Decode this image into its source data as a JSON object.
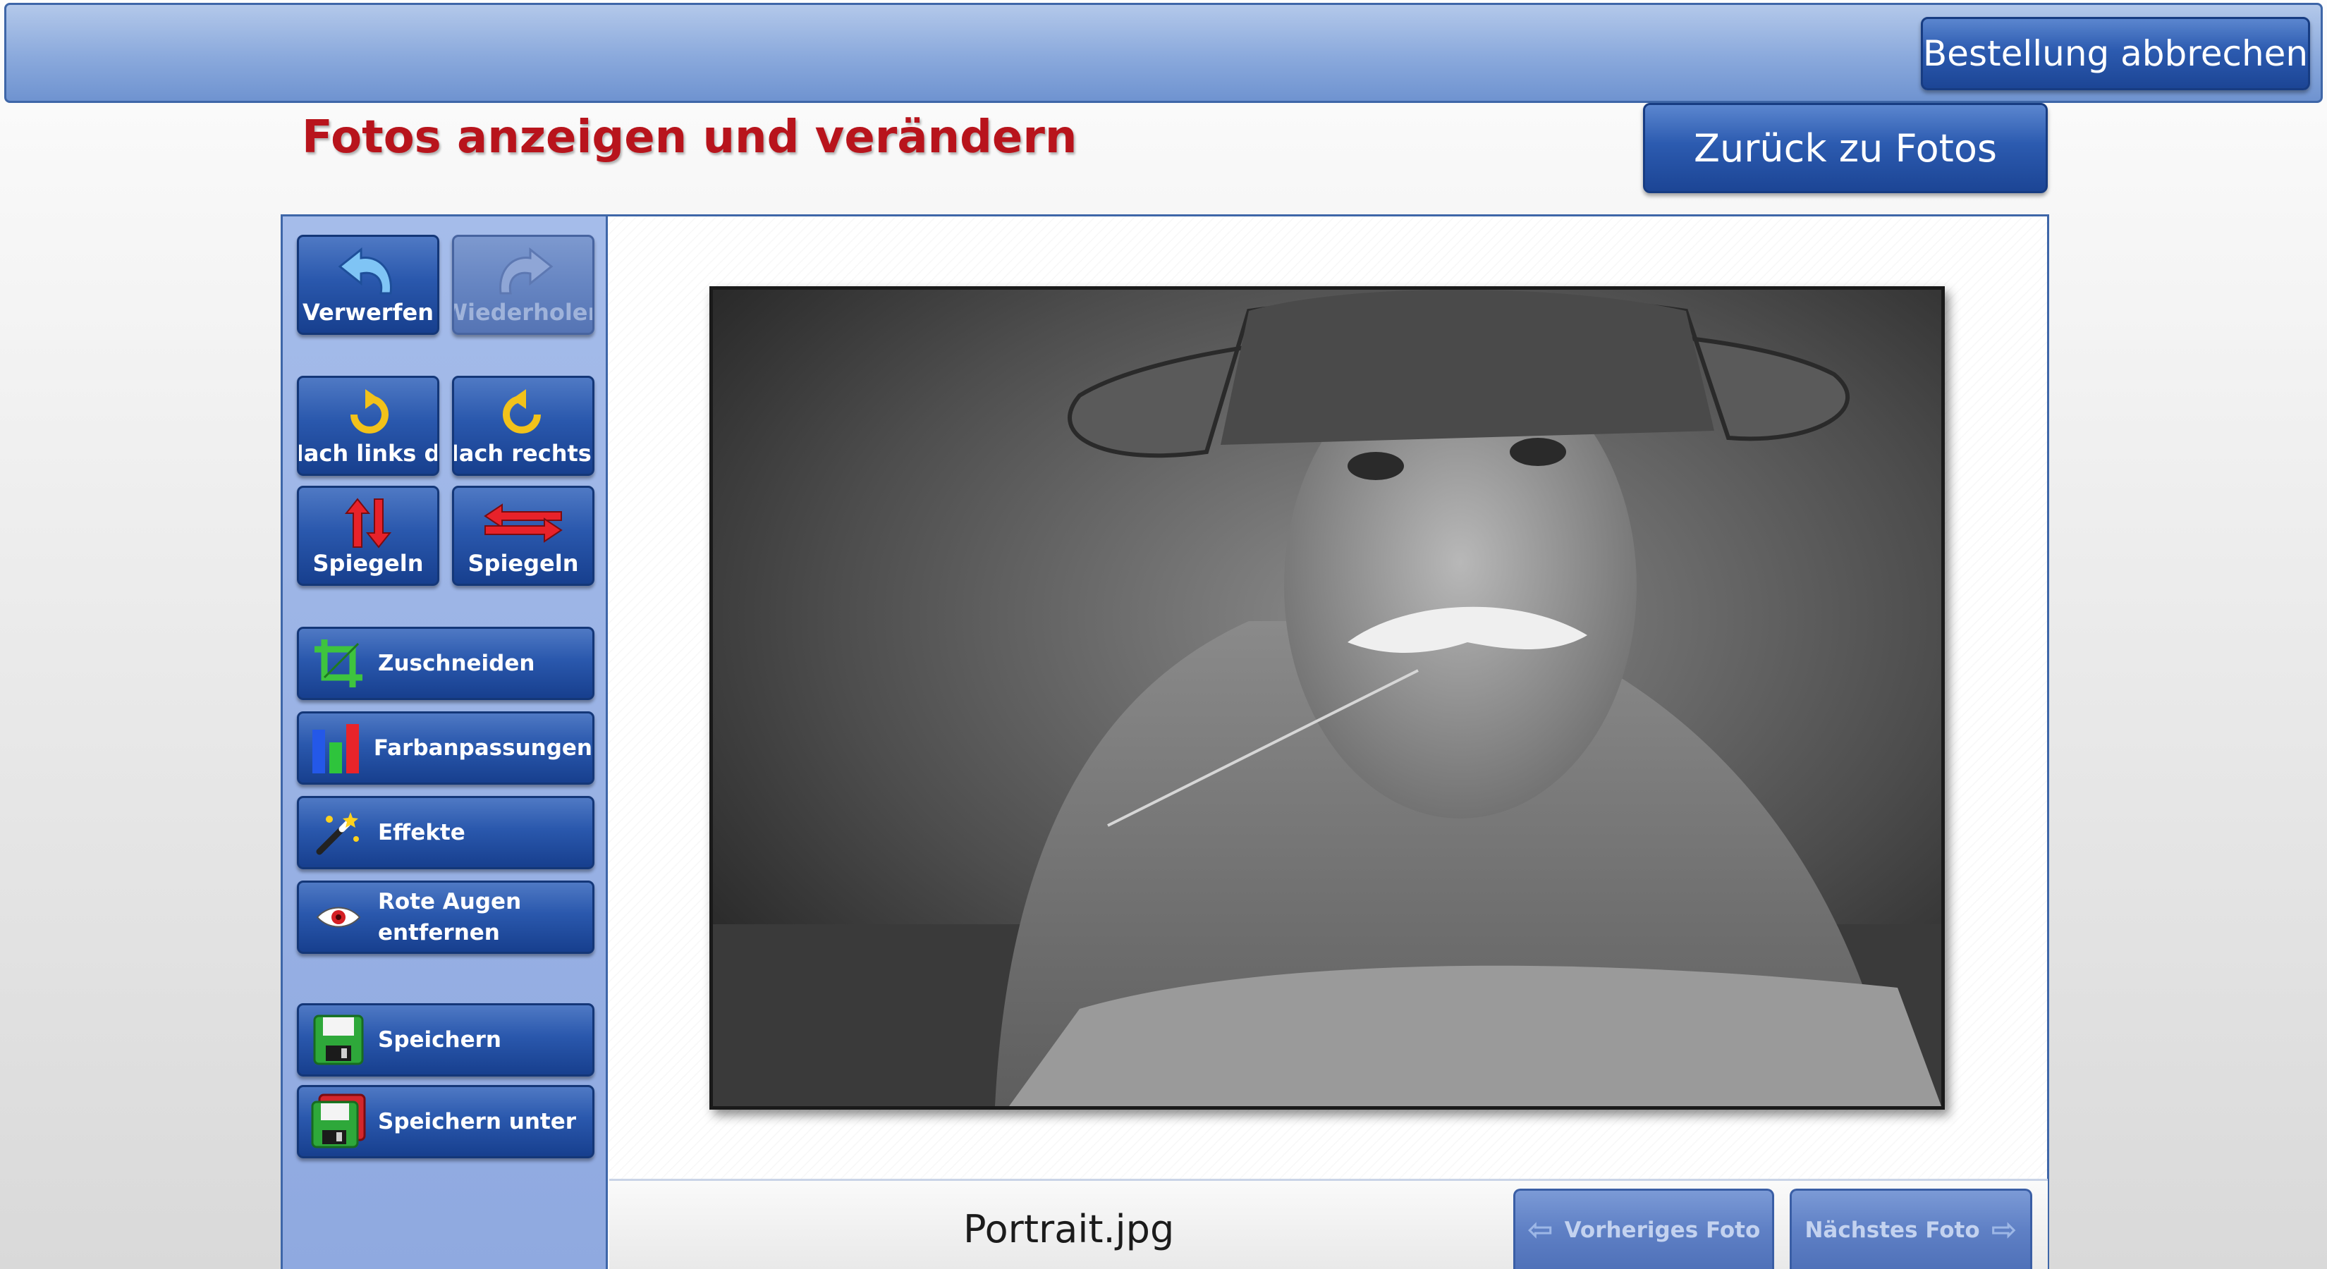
{
  "header": {
    "cancel_label": "Bestellung abbrechen"
  },
  "page": {
    "title": "Fotos anzeigen und verändern",
    "back_label": "Zurück zu Fotos"
  },
  "sidebar": {
    "undo_label": "Verwerfen",
    "redo_label": "Wiederholen",
    "rotate_left_label": "Nach links drehen",
    "rotate_right_label": "Nach rechts drehen",
    "flip_vertical_label": "Spiegeln",
    "flip_horizontal_label": "Spiegeln",
    "crop_label": "Zuschneiden",
    "color_label": "Farbanpassungen",
    "effects_label": "Effekte",
    "red_eye_label": "Rote Augen entfernen",
    "save_label": "Speichern",
    "save_as_label": "Speichern unter"
  },
  "photo": {
    "file_name": "Portrait.jpg"
  },
  "navigation": {
    "prev_label": "Vorheriges Foto",
    "next_label": "Nächstes Foto"
  },
  "icons": {
    "undo": "undo-arrow-icon",
    "redo": "redo-arrow-icon",
    "rotate_left": "rotate-left-icon",
    "rotate_right": "rotate-right-icon",
    "flip_vertical": "flip-vertical-icon",
    "flip_horizontal": "flip-horizontal-icon",
    "crop": "crop-icon",
    "color": "bar-chart-icon",
    "effects": "magic-wand-icon",
    "red_eye": "eye-icon",
    "save": "floppy-disk-icon",
    "save_as": "floppy-disk-stack-icon"
  },
  "colors": {
    "title_red": "#b8141c",
    "button_blue": "#2c5bb0",
    "sidebar_blue": "#8fa9e0"
  }
}
